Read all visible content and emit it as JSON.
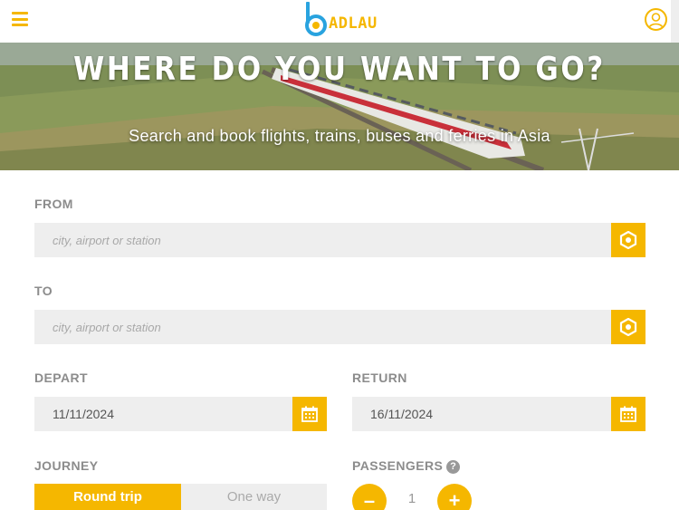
{
  "header": {
    "menu_icon": "hamburger-icon",
    "logo_text": "ADLAU",
    "user_icon": "user-icon"
  },
  "hero": {
    "title": "WHERE DO YOU WANT TO GO?",
    "subtitle": "Search and book flights, trains, buses and ferries in Asia"
  },
  "form": {
    "from": {
      "label": "FROM",
      "placeholder": "city, airport or station",
      "locate_icon": "locate-icon"
    },
    "to": {
      "label": "TO",
      "placeholder": "city, airport or station",
      "locate_icon": "locate-icon"
    },
    "depart": {
      "label": "DEPART",
      "value": "11/11/2024",
      "icon": "calendar-icon"
    },
    "return": {
      "label": "RETURN",
      "value": "16/11/2024",
      "icon": "calendar-icon"
    },
    "journey": {
      "label": "JOURNEY",
      "options": [
        "Round trip",
        "One way"
      ],
      "selected": "Round trip"
    },
    "passengers": {
      "label": "PASSENGERS",
      "help_symbol": "?",
      "minus": "–",
      "count": "1",
      "plus": "+"
    }
  },
  "colors": {
    "accent": "#f5b700",
    "field_bg": "#eeeeee",
    "label": "#8c8c8c"
  }
}
